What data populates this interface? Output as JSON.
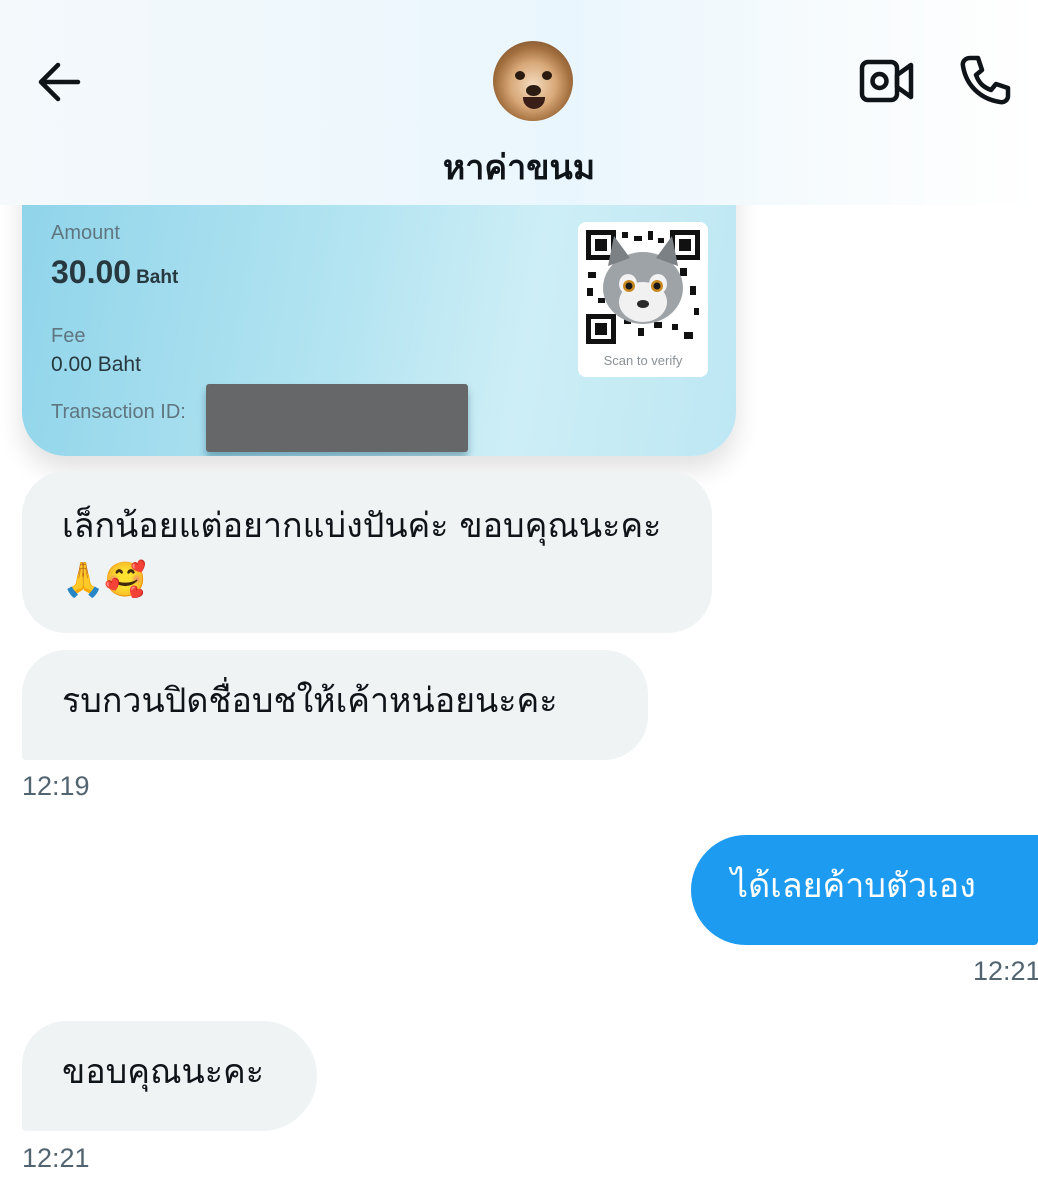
{
  "header": {
    "title": "หาค่าขนม",
    "back_icon": "arrow-left-icon",
    "video_icon": "video-camera-icon",
    "call_icon": "phone-icon"
  },
  "slip": {
    "amount_label": "Amount",
    "amount_value": "30.00",
    "amount_unit": "Baht",
    "fee_label": "Fee",
    "fee_value": "0.00 Baht",
    "txn_label": "Transaction ID:",
    "scan_label": "Scan to verify"
  },
  "messages": [
    {
      "text": "เล็กน้อยแต่อยากแบ่งปันค่ะ ขอบคุณนะคะ 🙏🥰",
      "direction": "incoming"
    },
    {
      "text": "รบกวนปิดชื่อบชให้เค้าหน่อยนะคะ",
      "direction": "incoming"
    },
    {
      "text": "ได้เลยค้าบตัวเอง",
      "direction": "outgoing"
    },
    {
      "text": "ขอบคุณนะคะ",
      "direction": "incoming"
    }
  ],
  "timestamps": [
    "12:19",
    "12:21",
    "12:21"
  ],
  "colors": {
    "outgoing_bubble": "#1d9bf0",
    "incoming_bubble": "#eff3f4",
    "timestamp": "#536471"
  }
}
